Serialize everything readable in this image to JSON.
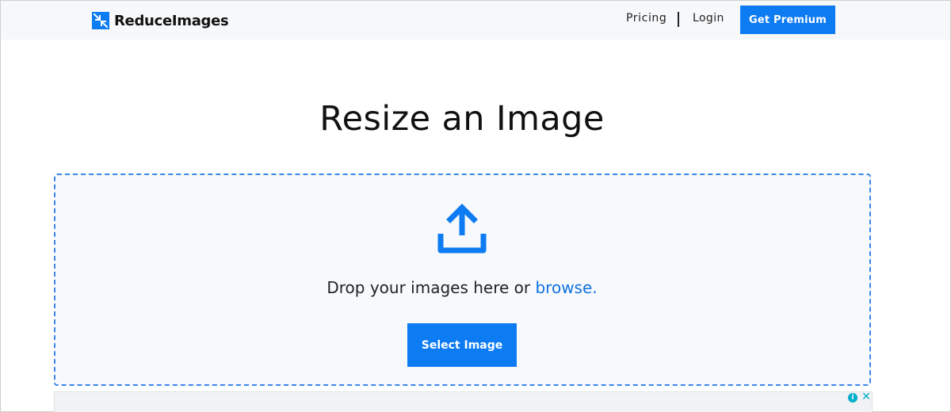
{
  "header": {
    "brand": "ReduceImages",
    "nav": {
      "pricing": "Pricing",
      "login": "Login"
    },
    "premium_button": "Get Premium"
  },
  "main": {
    "title": "Resize an Image",
    "dropzone": {
      "prompt": "Drop your images here or",
      "browse_link": "browse.",
      "select_button": "Select Image",
      "icon": "upload-icon"
    }
  },
  "ad": {
    "info_icon": "info-icon",
    "close_icon": "close-icon"
  },
  "colors": {
    "accent": "#0d7bf2",
    "link": "#1271e0",
    "dropzone_border": "#3a86e8",
    "header_bg": "#f7f8fa"
  }
}
